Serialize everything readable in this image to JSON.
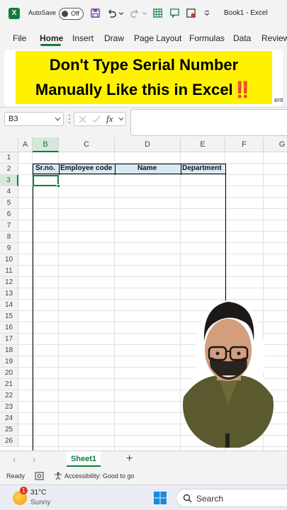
{
  "titlebar": {
    "autosave_label": "AutoSave",
    "toggle_state": "Off",
    "document_title": "Book1 - Excel",
    "app_icon": "excel-icon",
    "quick_access_icons": [
      "save-icon",
      "undo-icon",
      "redo-icon",
      "table-icon",
      "comment-icon",
      "form-icon",
      "customize-icon"
    ]
  },
  "ribbon": {
    "tabs": [
      "File",
      "Home",
      "Insert",
      "Draw",
      "Page Layout",
      "Formulas",
      "Data",
      "Review"
    ],
    "active_tab": "Home",
    "partial_text": "ent"
  },
  "banner": {
    "line1": "Don't Type Serial Number",
    "line2": "Manually Like this in Excel",
    "line2_emoji": "‼️",
    "background_color": "#fff200"
  },
  "formula_bar": {
    "name_box": "B3",
    "fx_label": "fx",
    "formula_value": ""
  },
  "grid": {
    "columns": [
      "A",
      "B",
      "C",
      "D",
      "E",
      "F",
      "G"
    ],
    "selected_column": "B",
    "rows": [
      "1",
      "2",
      "3",
      "4",
      "5",
      "6",
      "7",
      "8",
      "9",
      "10",
      "11",
      "12",
      "13",
      "14",
      "15",
      "16",
      "17",
      "18",
      "19",
      "20",
      "21",
      "22",
      "23",
      "24",
      "25",
      "26"
    ],
    "selected_row": "3",
    "table_headers": [
      "Sr.no.",
      "Employee code",
      "Name",
      "Department"
    ],
    "header_fill_color": "#d7eaf5",
    "accent_color": "#107c41"
  },
  "sheets": {
    "tabs": [
      "Sheet1"
    ],
    "add_label": "+"
  },
  "statusbar": {
    "ready": "Ready",
    "accessibility": "Accessibility: Good to go"
  },
  "taskbar": {
    "temperature": "31°C",
    "condition": "Sunny",
    "badge": "1",
    "search_label": "Search"
  }
}
